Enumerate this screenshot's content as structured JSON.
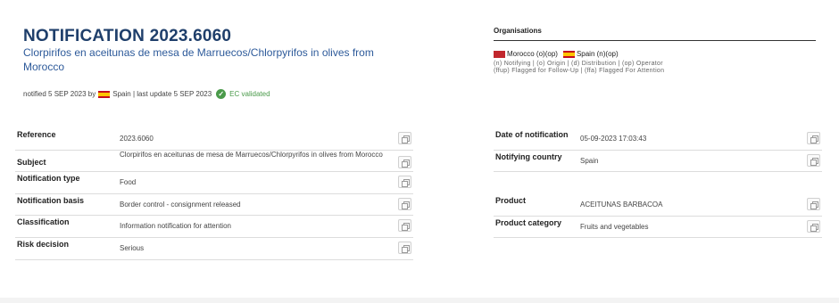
{
  "header": {
    "title": "NOTIFICATION 2023.6060",
    "subject": "Clorpirifos en aceitunas de mesa de Marruecos/Chlorpyrifos in olives from Morocco",
    "notified_prefix": "notified 5 SEP 2023 by",
    "notified_country": "Spain",
    "last_update": "| last update 5 SEP 2023",
    "validated": "EC validated"
  },
  "organisations": {
    "title": "Organisations",
    "entries": [
      {
        "country": "Morocco",
        "roles": "(o)(op)",
        "flag": "flag-ma"
      },
      {
        "country": "Spain",
        "roles": "(n)(op)",
        "flag": "flag-es"
      }
    ],
    "legend_line1": "(n) Notifying | (o) Origin | (d) Distribution | (op) Operator",
    "legend_line2": "(ffup) Flagged for Follow-Up | (ffa) Flagged For Attention"
  },
  "details": {
    "reference": {
      "label": "Reference",
      "value": "2023.6060"
    },
    "subject": {
      "label": "Subject",
      "value": "Clorpirifos en aceitunas de mesa de Marruecos/Chlorpyrifos in olives from Morocco"
    },
    "notification_type": {
      "label": "Notification type",
      "value": "Food"
    },
    "notification_basis": {
      "label": "Notification basis",
      "value": "Border control - consignment released"
    },
    "classification": {
      "label": "Classification",
      "value": "Information notification for attention"
    },
    "risk_decision": {
      "label": "Risk decision",
      "value": "Serious"
    },
    "date_of_notification": {
      "label": "Date of notification",
      "value": "05-09-2023 17:03:43"
    },
    "notifying_country": {
      "label": "Notifying country",
      "value": "Spain"
    },
    "product": {
      "label": "Product",
      "value": "ACEITUNAS BARBACOA"
    },
    "product_category": {
      "label": "Product category",
      "value": "Fruits and vegetables"
    }
  }
}
